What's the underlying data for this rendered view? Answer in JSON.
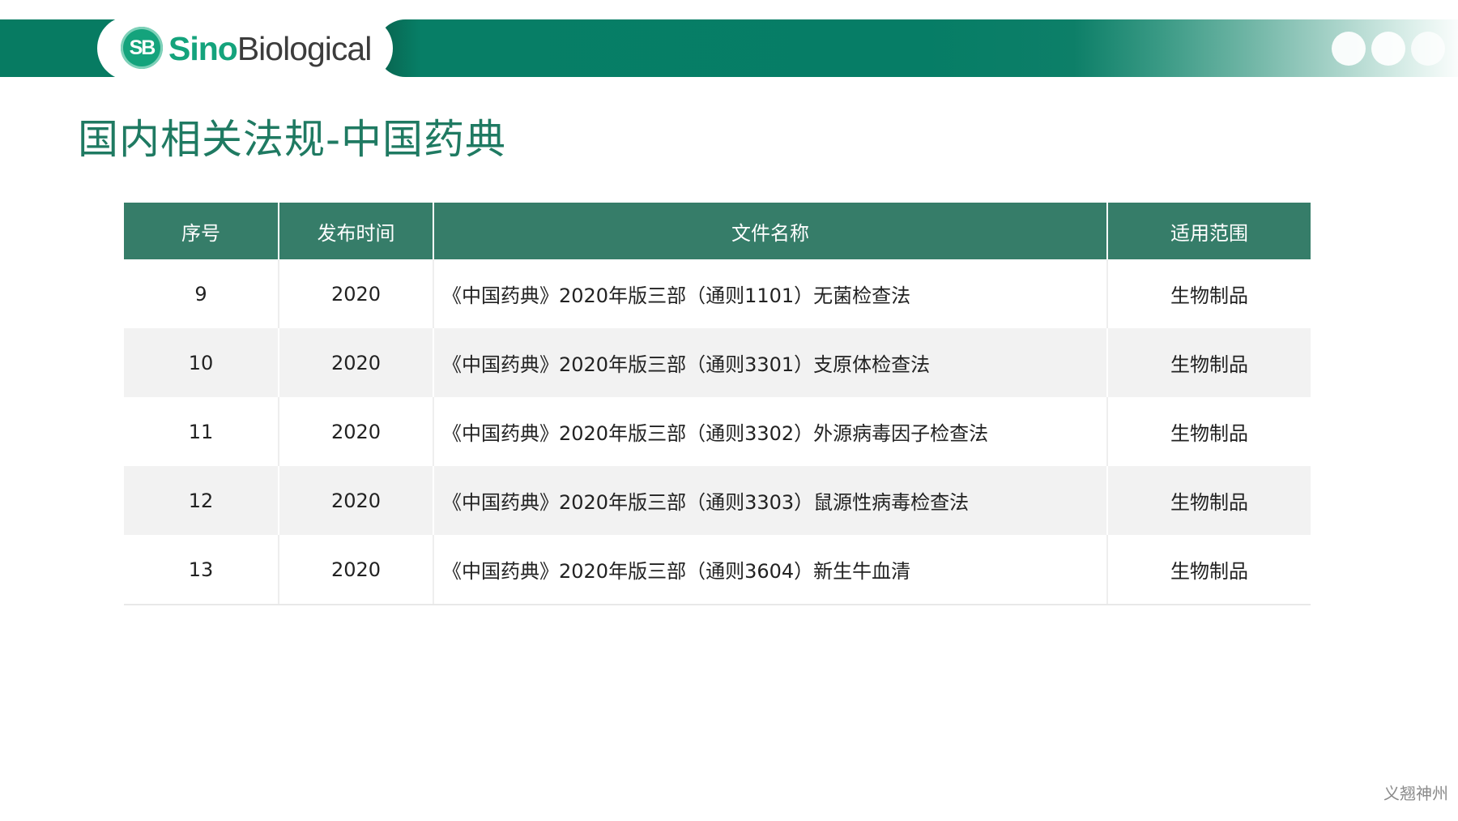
{
  "header": {
    "logo_badge": "SB",
    "logo_brand": "Sino",
    "logo_suffix": "Biological"
  },
  "title": "国内相关法规-中国药典",
  "table": {
    "headers": [
      "序号",
      "发布时间",
      "文件名称",
      "适用范围"
    ],
    "rows": [
      [
        "9",
        "2020",
        "《中国药典》2020年版三部（通则1101）无菌检查法",
        "生物制品"
      ],
      [
        "10",
        "2020",
        "《中国药典》2020年版三部（通则3301）支原体检查法",
        "生物制品"
      ],
      [
        "11",
        "2020",
        "《中国药典》2020年版三部（通则3302）外源病毒因子检查法",
        "生物制品"
      ],
      [
        "12",
        "2020",
        "《中国药典》2020年版三部（通则3303）鼠源性病毒检查法",
        "生物制品"
      ],
      [
        "13",
        "2020",
        "《中国药典》2020年版三部（通则3604）新生牛血清",
        "生物制品"
      ]
    ]
  },
  "footer": {
    "text": "义翘神州"
  },
  "colors": {
    "brand_green": "#077b62",
    "header_row": "#367d69",
    "title_text": "#1f7a62",
    "stripe": "#f2f2f2"
  }
}
